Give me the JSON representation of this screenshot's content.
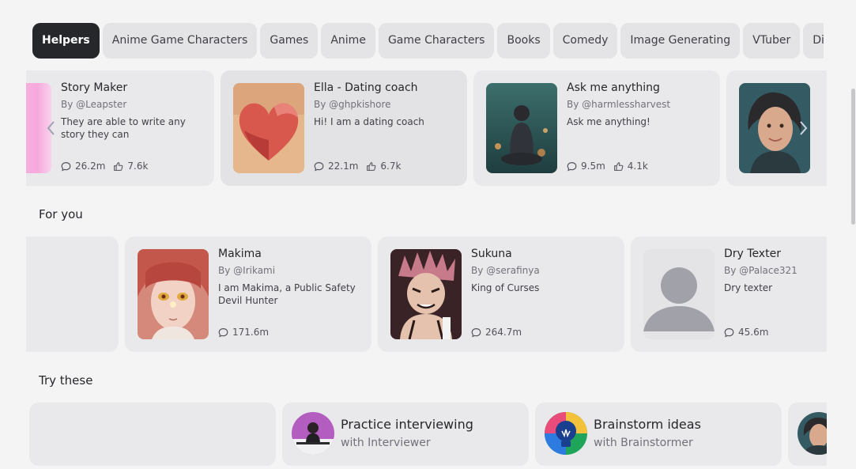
{
  "tabs": [
    "Helpers",
    "Anime Game Characters",
    "Games",
    "Anime",
    "Game Characters",
    "Books",
    "Comedy",
    "Image Generating",
    "VTuber",
    "Discu"
  ],
  "featured": [
    {
      "title": "Story Maker",
      "author": "By @Leapster",
      "desc": "They are able to write any story they can",
      "chats": "26.2m",
      "likes": "7.6k"
    },
    {
      "title": "Ella - Dating coach",
      "author": "By @ghpkishore",
      "desc": "Hi! I am a dating coach",
      "chats": "22.1m",
      "likes": "6.7k"
    },
    {
      "title": "Ask me anything",
      "author": "By @harmlessharvest",
      "desc": "Ask me anything!",
      "chats": "9.5m",
      "likes": "4.1k"
    }
  ],
  "for_you": {
    "title": "For you",
    "cards": [
      {
        "title": "Makima",
        "author": "By @Irikami",
        "desc": "I am Makima, a Public Safety Devil Hunter",
        "chats": "171.6m"
      },
      {
        "title": "Sukuna",
        "author": "By @serafinya",
        "desc": "King of Curses",
        "chats": "264.7m"
      },
      {
        "title": "Dry Texter",
        "author": "By @Palace321",
        "desc": "Dry texter",
        "chats": "45.6m"
      }
    ]
  },
  "try_these": {
    "title": "Try these",
    "cards": [
      {
        "title": "Practice interviewing",
        "sub": "with Interviewer"
      },
      {
        "title": "Brainstorm ideas",
        "sub": "with Brainstormer"
      }
    ]
  },
  "icons": {
    "chat": "chat-bubble-icon",
    "like": "thumbs-up-icon",
    "prev": "chevron-left-icon",
    "next": "chevron-right-icon"
  }
}
